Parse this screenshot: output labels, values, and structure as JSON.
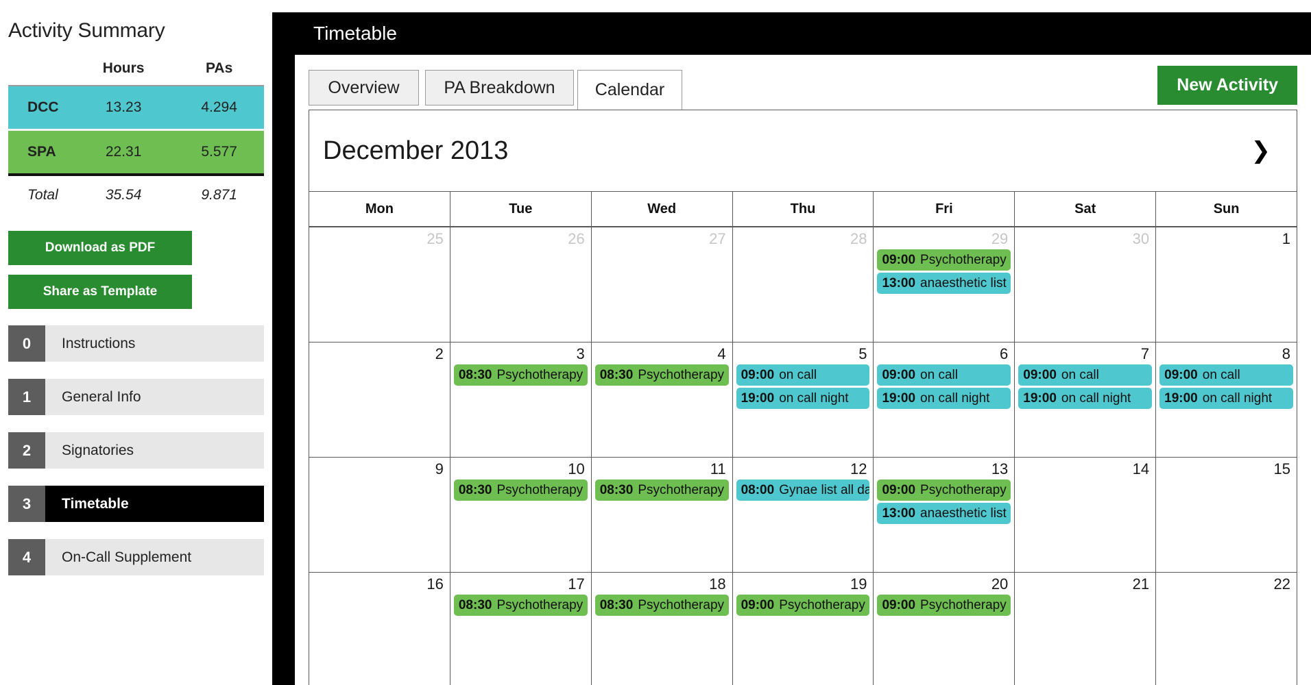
{
  "sidebar": {
    "title": "Activity Summary",
    "summary": {
      "headers": [
        "",
        "Hours",
        "PAs"
      ],
      "rows": [
        {
          "label": "DCC",
          "hours": "13.23",
          "pas": "4.294",
          "color": "#4ec8ce"
        },
        {
          "label": "SPA",
          "hours": "22.31",
          "pas": "5.577",
          "color": "#6ebe51"
        },
        {
          "label": "Total",
          "hours": "35.54",
          "pas": "9.871",
          "color": "#ffffff"
        }
      ]
    },
    "buttons": [
      {
        "label": "Download as PDF"
      },
      {
        "label": "Share as Template"
      }
    ],
    "nav": [
      {
        "num": "0",
        "label": "Instructions",
        "active": false
      },
      {
        "num": "1",
        "label": "General Info",
        "active": false
      },
      {
        "num": "2",
        "label": "Signatories",
        "active": false
      },
      {
        "num": "3",
        "label": "Timetable",
        "active": true
      },
      {
        "num": "4",
        "label": "On-Call Supplement",
        "active": false
      }
    ]
  },
  "header": {
    "title": "Timetable"
  },
  "tabs": [
    {
      "label": "Overview",
      "active": false
    },
    {
      "label": "PA Breakdown",
      "active": false
    },
    {
      "label": "Calendar",
      "active": true
    }
  ],
  "actions": {
    "new_activity": "New Activity"
  },
  "calendar": {
    "month_label": "December 2013",
    "next_icon": "chevron-right-icon",
    "next_glyph": "❯",
    "day_headers": [
      "Mon",
      "Tue",
      "Wed",
      "Thu",
      "Fri",
      "Sat",
      "Sun"
    ],
    "colors": {
      "dcc": "#4ec8ce",
      "spa": "#6ebe51"
    },
    "weeks": [
      [
        {
          "num": "25",
          "other": true,
          "events": []
        },
        {
          "num": "26",
          "other": true,
          "events": []
        },
        {
          "num": "27",
          "other": true,
          "events": []
        },
        {
          "num": "28",
          "other": true,
          "events": []
        },
        {
          "num": "29",
          "other": true,
          "events": [
            {
              "time": "09:00",
              "name": "Psychotherapy",
              "type": "spa"
            },
            {
              "time": "13:00",
              "name": "anaesthetic list",
              "type": "dcc"
            }
          ]
        },
        {
          "num": "30",
          "other": true,
          "events": []
        },
        {
          "num": "1",
          "other": false,
          "events": []
        }
      ],
      [
        {
          "num": "2",
          "other": false,
          "events": []
        },
        {
          "num": "3",
          "other": false,
          "events": [
            {
              "time": "08:30",
              "name": "Psychotherapy",
              "type": "spa"
            }
          ]
        },
        {
          "num": "4",
          "other": false,
          "events": [
            {
              "time": "08:30",
              "name": "Psychotherapy",
              "type": "spa"
            }
          ]
        },
        {
          "num": "5",
          "other": false,
          "events": [
            {
              "time": "09:00",
              "name": "on call",
              "type": "dcc"
            },
            {
              "time": "19:00",
              "name": "on call night",
              "type": "dcc"
            }
          ]
        },
        {
          "num": "6",
          "other": false,
          "events": [
            {
              "time": "09:00",
              "name": "on call",
              "type": "dcc"
            },
            {
              "time": "19:00",
              "name": "on call night",
              "type": "dcc"
            }
          ]
        },
        {
          "num": "7",
          "other": false,
          "events": [
            {
              "time": "09:00",
              "name": "on call",
              "type": "dcc"
            },
            {
              "time": "19:00",
              "name": "on call night",
              "type": "dcc"
            }
          ]
        },
        {
          "num": "8",
          "other": false,
          "events": [
            {
              "time": "09:00",
              "name": "on call",
              "type": "dcc"
            },
            {
              "time": "19:00",
              "name": "on call night",
              "type": "dcc"
            }
          ]
        }
      ],
      [
        {
          "num": "9",
          "other": false,
          "events": []
        },
        {
          "num": "10",
          "other": false,
          "events": [
            {
              "time": "08:30",
              "name": "Psychotherapy",
              "type": "spa"
            }
          ]
        },
        {
          "num": "11",
          "other": false,
          "events": [
            {
              "time": "08:30",
              "name": "Psychotherapy",
              "type": "spa"
            }
          ]
        },
        {
          "num": "12",
          "other": false,
          "events": [
            {
              "time": "08:00",
              "name": "Gynae list all day",
              "type": "dcc"
            }
          ]
        },
        {
          "num": "13",
          "other": false,
          "events": [
            {
              "time": "09:00",
              "name": "Psychotherapy",
              "type": "spa"
            },
            {
              "time": "13:00",
              "name": "anaesthetic list",
              "type": "dcc"
            }
          ]
        },
        {
          "num": "14",
          "other": false,
          "events": []
        },
        {
          "num": "15",
          "other": false,
          "events": []
        }
      ],
      [
        {
          "num": "16",
          "other": false,
          "events": []
        },
        {
          "num": "17",
          "other": false,
          "events": [
            {
              "time": "08:30",
              "name": "Psychotherapy",
              "type": "spa"
            }
          ]
        },
        {
          "num": "18",
          "other": false,
          "events": [
            {
              "time": "08:30",
              "name": "Psychotherapy",
              "type": "spa"
            }
          ]
        },
        {
          "num": "19",
          "other": false,
          "events": [
            {
              "time": "09:00",
              "name": "Psychotherapy",
              "type": "spa"
            }
          ]
        },
        {
          "num": "20",
          "other": false,
          "events": [
            {
              "time": "09:00",
              "name": "Psychotherapy",
              "type": "spa"
            }
          ]
        },
        {
          "num": "21",
          "other": false,
          "events": []
        },
        {
          "num": "22",
          "other": false,
          "events": []
        }
      ]
    ]
  }
}
